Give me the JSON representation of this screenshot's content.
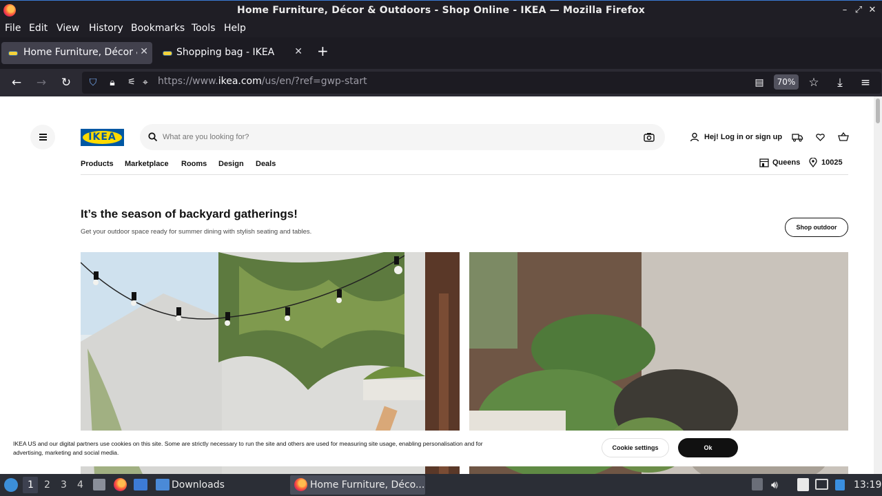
{
  "window": {
    "title": "Home Furniture, Décor & Outdoors - Shop Online - IKEA — Mozilla Firefox"
  },
  "menu": [
    "File",
    "Edit",
    "View",
    "History",
    "Bookmarks",
    "Tools",
    "Help"
  ],
  "tabs": [
    {
      "label": "Home Furniture, Décor & Outdoors",
      "active": true
    },
    {
      "label": "Shopping bag - IKEA",
      "active": false
    }
  ],
  "navbar": {
    "url_prefix": "https://www.",
    "url_host": "ikea.com",
    "url_path": "/us/en/?ref=gwp-start",
    "zoom": "70%"
  },
  "site": {
    "logo_text": "IKEA",
    "search_placeholder": "What are you looking for?",
    "login_label": "Hej! Log in or sign up",
    "nav": [
      "Products",
      "Marketplace",
      "Rooms",
      "Design",
      "Deals"
    ],
    "store": "Queens",
    "zip": "10025",
    "headline": "It’s the season of backyard gatherings!",
    "subline": "Get your outdoor space ready for summer dining with stylish seating and tables.",
    "shop_button": "Shop outdoor"
  },
  "cookie": {
    "text": "IKEA US and our digital partners use cookies on this site. Some are strictly necessary to run the site and others are used for measuring site usage, enabling personalisation and for advertising, marketing and social media.",
    "settings_label": "Cookie settings",
    "ok_label": "Ok"
  },
  "taskbar": {
    "workspaces": [
      "1",
      "2",
      "3",
      "4"
    ],
    "active_workspace": "1",
    "folder_label": "Downloads",
    "task_label": "Home Furniture, Déco...",
    "clock": "13:19"
  },
  "colors": {
    "ikea_blue": "#0058a3",
    "ikea_yellow": "#ffdb00",
    "titlebar": "#1f1e25",
    "tab_active": "#42414d",
    "navbar": "#2b2a33"
  }
}
